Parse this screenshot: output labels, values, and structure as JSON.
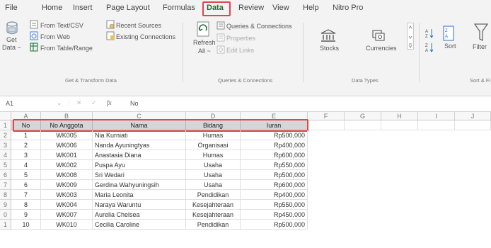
{
  "menu": {
    "tabs": [
      {
        "label": "File"
      },
      {
        "label": "Home"
      },
      {
        "label": "Insert"
      },
      {
        "label": "Page Layout"
      },
      {
        "label": "Formulas"
      },
      {
        "label": "Data"
      },
      {
        "label": "Review"
      },
      {
        "label": "View"
      },
      {
        "label": "Help"
      },
      {
        "label": "Nitro Pro"
      }
    ],
    "active": "Data"
  },
  "ribbon": {
    "get_transform": {
      "get_data": "Get",
      "get_data_2": "Data ~",
      "from_text_csv": "From Text/CSV",
      "from_web": "From Web",
      "from_table_range": "From Table/Range",
      "recent_sources": "Recent Sources",
      "existing_connections": "Existing Connections",
      "label": "Get & Transform Data"
    },
    "queries": {
      "refresh": "Refresh",
      "refresh_all": "All ~",
      "queries_connections": "Queries & Connections",
      "properties": "Properties",
      "edit_links": "Edit Links",
      "label": "Queries & Connections"
    },
    "data_types": {
      "stocks": "Stocks",
      "currencies": "Currencies",
      "label": "Data Types"
    },
    "sort_filter": {
      "sort": "Sort",
      "filter": "Filter",
      "label": "Sort & Fi"
    }
  },
  "formula_bar": {
    "name_box": "A1",
    "fx": "fx",
    "content": "No"
  },
  "grid": {
    "columns": [
      "A",
      "B",
      "C",
      "D",
      "E",
      "F",
      "G",
      "H",
      "I",
      "J"
    ],
    "row_numbers": [
      "1",
      "2",
      "3",
      "4",
      "5",
      "6",
      "7",
      "8",
      "9",
      "0",
      "1"
    ],
    "headers": [
      "No",
      "No Anggota",
      "Nama",
      "Bidang",
      "Iuran"
    ],
    "rows": [
      [
        "1",
        "WK005",
        "Nia Kurniati",
        "Humas",
        "Rp500,000"
      ],
      [
        "2",
        "WK006",
        "Nanda Ayuningtyas",
        "Organisasi",
        "Rp400,000"
      ],
      [
        "3",
        "WK001",
        "Anastasia Diana",
        "Humas",
        "Rp600,000"
      ],
      [
        "4",
        "WK002",
        "Puspa Ayu",
        "Usaha",
        "Rp550,000"
      ],
      [
        "5",
        "WK008",
        "Sri Wedari",
        "Usaha",
        "Rp500,000"
      ],
      [
        "6",
        "WK009",
        "Gerdina Wahyuningsih",
        "Usaha",
        "Rp600,000"
      ],
      [
        "7",
        "WK003",
        "Maria Leonita",
        "Pendidikan",
        "Rp400,000"
      ],
      [
        "8",
        "WK004",
        "Naraya Waruntu",
        "Kesejahteraan",
        "Rp550,000"
      ],
      [
        "9",
        "WK007",
        "Aurelia Chelsea",
        "Kesejahteraan",
        "Rp450,000"
      ],
      [
        "10",
        "WK010",
        "Cecilia Caroline",
        "Pendidikan",
        "Rp500,000"
      ]
    ]
  },
  "colors": {
    "highlight": "#e0464b",
    "header_fill": "#d6d6d6",
    "active_tab": "#1e6b3c"
  }
}
